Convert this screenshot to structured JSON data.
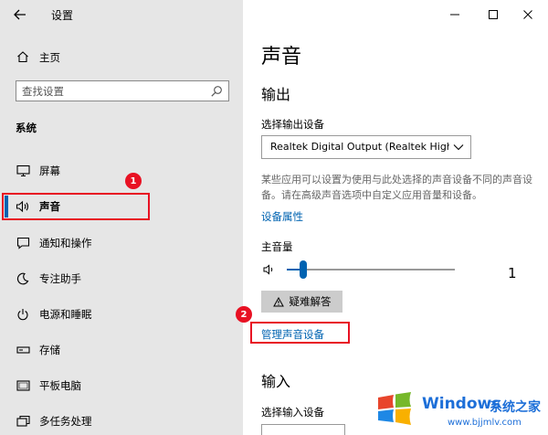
{
  "window": {
    "title": "设置"
  },
  "sidebar": {
    "home_label": "主页",
    "search_placeholder": "查找设置",
    "section_title": "系统",
    "items": [
      {
        "label": "屏幕",
        "icon": "monitor-icon"
      },
      {
        "label": "声音",
        "icon": "speaker-icon",
        "active": true
      },
      {
        "label": "通知和操作",
        "icon": "notification-icon"
      },
      {
        "label": "专注助手",
        "icon": "moon-icon"
      },
      {
        "label": "电源和睡眠",
        "icon": "power-icon"
      },
      {
        "label": "存储",
        "icon": "storage-icon"
      },
      {
        "label": "平板电脑",
        "icon": "tablet-icon"
      },
      {
        "label": "多任务处理",
        "icon": "multitask-icon"
      }
    ]
  },
  "annotations": {
    "badge1": "1",
    "badge2": "2"
  },
  "content": {
    "title": "声音",
    "output_heading": "输出",
    "output_device_label": "选择输出设备",
    "output_device_value": "Realtek Digital Output (Realtek High...",
    "description": "某些应用可以设置为使用与此处选择的声音设备不同的声音设备。请在高级声音选项中自定义应用音量和设备。",
    "device_properties_link": "设备属性",
    "master_volume_label": "主音量",
    "volume_value": "1",
    "volume_fraction": 0.01,
    "troubleshoot_label": "疑难解答",
    "manage_devices_link": "管理声音设备",
    "input_heading": "输入",
    "input_device_label": "选择输入设备"
  },
  "watermark": {
    "brand": "Windows",
    "suffix": "系统之家",
    "url": "www.bjjmlv.com"
  },
  "colors": {
    "accent": "#0063b1",
    "highlight": "#e81123",
    "sidebar_bg": "#e6e6e6"
  }
}
